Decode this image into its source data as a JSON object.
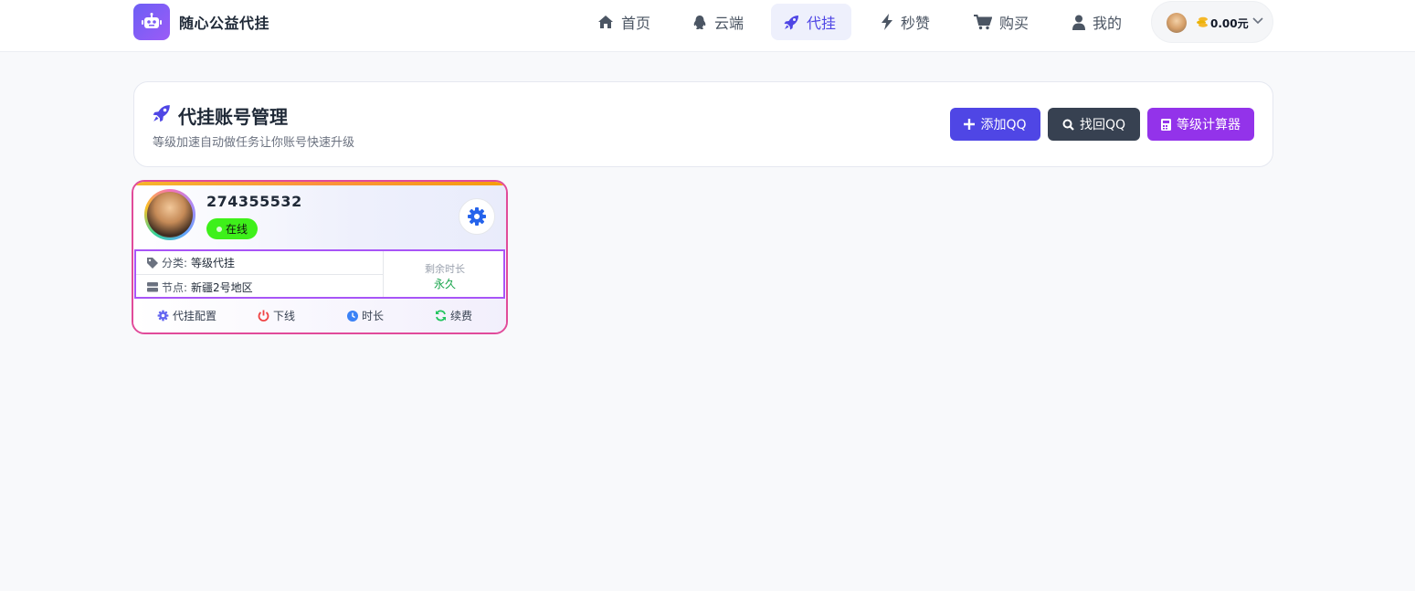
{
  "header": {
    "site_title": "随心公益代挂",
    "nav": [
      {
        "label": "首页",
        "icon": "home-icon"
      },
      {
        "label": "云端",
        "icon": "qq-penguin-icon"
      },
      {
        "label": "代挂",
        "icon": "rocket-icon",
        "active": true
      },
      {
        "label": "秒赞",
        "icon": "bolt-icon"
      },
      {
        "label": "购买",
        "icon": "cart-icon"
      },
      {
        "label": "我的",
        "icon": "user-icon"
      }
    ],
    "balance": "0.00元"
  },
  "page": {
    "title": "代挂账号管理",
    "subtitle": "等级加速自动做任务让你账号快速升级",
    "buttons": {
      "add": "添加QQ",
      "find": "找回QQ",
      "calc": "等级计算器"
    }
  },
  "account": {
    "qq": "274355532",
    "status": "在线",
    "category_label": "分类:",
    "category_value": "等级代挂",
    "node_label": "节点:",
    "node_value": "新疆2号地区",
    "remain_label": "剩余时长",
    "remain_value": "永久",
    "actions": {
      "config": "代挂配置",
      "offline": "下线",
      "duration": "时长",
      "renew": "续费"
    }
  },
  "colors": {
    "accent": "#4f46e5",
    "status_online": "#3ef01a",
    "card_border": "#e14b9a"
  }
}
